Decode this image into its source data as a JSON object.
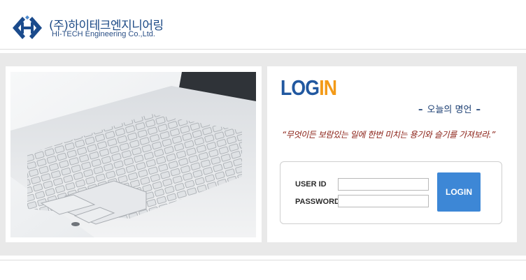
{
  "company": {
    "name": "(주)하이테크엔지니어링",
    "english_name": "HI-TECH Engineering Co.,Ltd.",
    "logo_icon": "company-logo-icon"
  },
  "login": {
    "title_part1": "LOG",
    "title_part2": "IN",
    "quote_heading": "오늘의 명언",
    "quote": "“무엇이든 보람있는 일에 한번 미치는 용기와 슬기를 가져보라.”",
    "user_id_label": "USER ID",
    "user_id_value": "",
    "password_label": "PASSWORD",
    "password_value": "",
    "button_label": "LOGIN"
  },
  "colors": {
    "brand_blue": "#2158a0",
    "accent_orange": "#f39a17",
    "button_blue": "#3d87d6",
    "quote_red": "#8a2016"
  }
}
